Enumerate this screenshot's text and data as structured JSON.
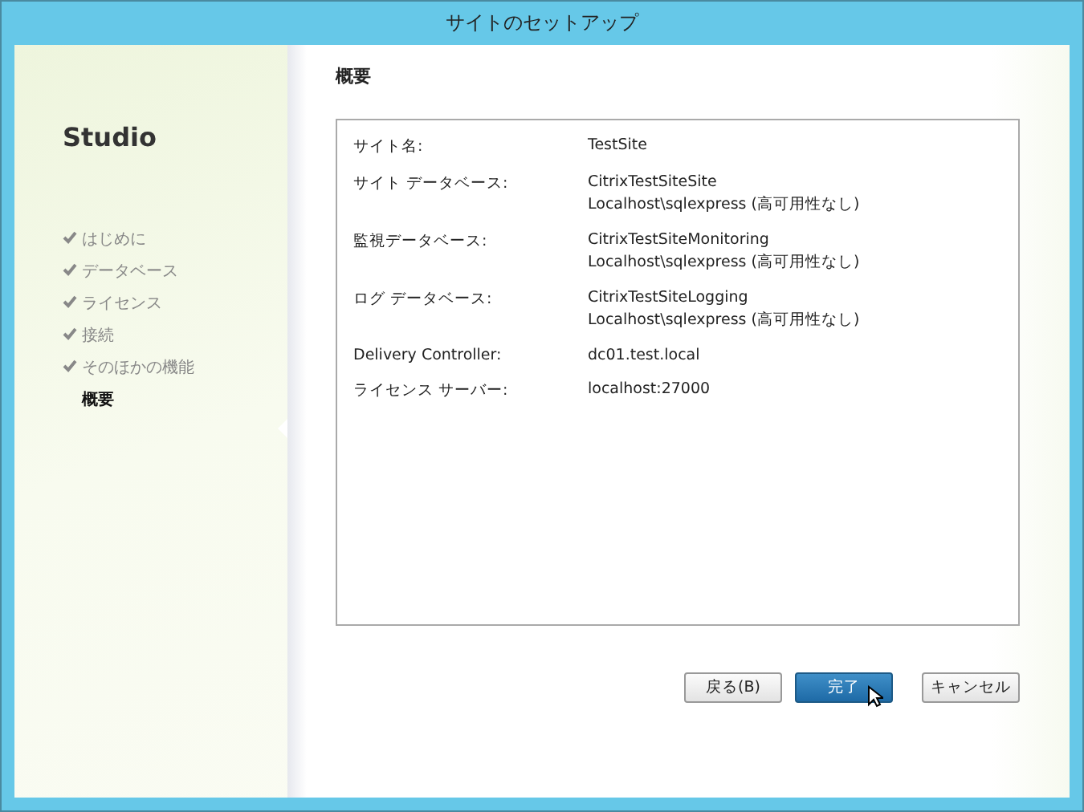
{
  "window": {
    "title": "サイトのセットアップ"
  },
  "sidebar": {
    "title": "Studio",
    "steps": [
      {
        "label": "はじめに",
        "completed": true,
        "selected": false
      },
      {
        "label": "データベース",
        "completed": true,
        "selected": false
      },
      {
        "label": "ライセンス",
        "completed": true,
        "selected": false
      },
      {
        "label": "接続",
        "completed": true,
        "selected": false
      },
      {
        "label": "そのほかの機能",
        "completed": true,
        "selected": false
      },
      {
        "label": "概要",
        "completed": false,
        "selected": true
      }
    ]
  },
  "summary": {
    "heading": "概要",
    "rows": [
      {
        "label": "サイト名:",
        "values": [
          "TestSite"
        ]
      },
      {
        "label": "サイト データベース:",
        "values": [
          "CitrixTestSiteSite",
          "Localhost\\sqlexpress (高可用性なし)"
        ]
      },
      {
        "label": "監視データベース:",
        "values": [
          "CitrixTestSiteMonitoring",
          "Localhost\\sqlexpress (高可用性なし)"
        ]
      },
      {
        "label": "ログ データベース:",
        "values": [
          "CitrixTestSiteLogging",
          "Localhost\\sqlexpress (高可用性なし)"
        ]
      },
      {
        "label": "Delivery Controller:",
        "values": [
          "dc01.test.local"
        ]
      },
      {
        "label": "ライセンス サーバー:",
        "values": [
          "localhost:27000"
        ]
      }
    ]
  },
  "buttons": [
    {
      "label": "戻る(B)",
      "primary": false
    },
    {
      "label": "完了",
      "primary": true
    },
    {
      "label": "キャンセル",
      "primary": false
    }
  ]
}
